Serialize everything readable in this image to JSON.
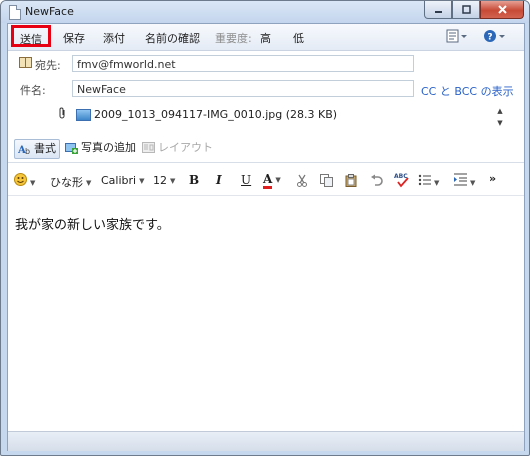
{
  "window": {
    "title": "NewFace"
  },
  "menubar": {
    "send": "送信",
    "save": "保存",
    "attach": "添付",
    "check_names": "名前の確認",
    "priority_label": "重要度:",
    "priority_high": "高",
    "priority_low": "低"
  },
  "header": {
    "to_label": "宛先:",
    "to_value": "fmv@fmworld.net",
    "subject_label": "件名:",
    "subject_value": "NewFace",
    "cc_link": "CC と BCC の表示",
    "attachment": "2009_1013_094117-IMG_0010.jpg (28.3 KB)"
  },
  "toolbar2": {
    "format": "書式",
    "add_photo": "写真の追加",
    "layout": "レイアウト"
  },
  "format_toolbar": {
    "style": "ひな形",
    "font": "Calibri",
    "size": "12",
    "bold": "B",
    "italic": "I",
    "underline": "U",
    "font_color": "A",
    "more": "»"
  },
  "body": {
    "text": "我が家の新しい家族です。"
  },
  "colors": {
    "highlight": "#e60012",
    "link": "#2a62c8",
    "window_frame": "#c6d8ee"
  }
}
